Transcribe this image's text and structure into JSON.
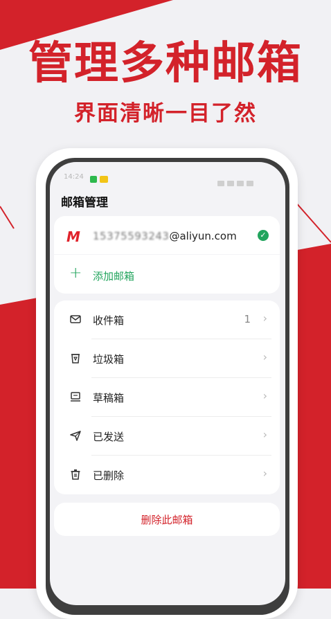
{
  "promo": {
    "headline": "管理多种邮箱",
    "subline": "界面清晰一目了然"
  },
  "statusbar": {
    "time": "14:24"
  },
  "page": {
    "title": "邮箱管理"
  },
  "account": {
    "email_prefix": "15375593243",
    "email_domain": "@aliyun.com",
    "add_label": "添加邮箱"
  },
  "folders": [
    {
      "label": "收件箱",
      "count": "1",
      "icon": "inbox-icon"
    },
    {
      "label": "垃圾箱",
      "count": "",
      "icon": "trash-bin-icon"
    },
    {
      "label": "草稿箱",
      "count": "",
      "icon": "drafts-icon"
    },
    {
      "label": "已发送",
      "count": "",
      "icon": "send-icon"
    },
    {
      "label": "已删除",
      "count": "",
      "icon": "delete-icon"
    }
  ],
  "actions": {
    "delete_mailbox": "删除此邮箱"
  },
  "colors": {
    "brand_red": "#d3222a",
    "accent_green": "#22a45d",
    "frame_dark": "#3e3e3e"
  }
}
